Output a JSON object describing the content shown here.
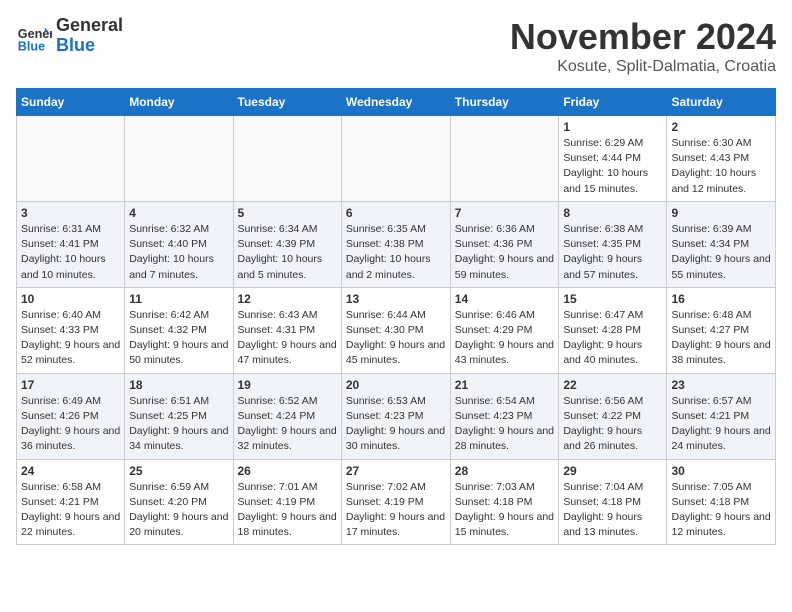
{
  "header": {
    "logo_general": "General",
    "logo_blue": "Blue",
    "month_title": "November 2024",
    "subtitle": "Kosute, Split-Dalmatia, Croatia"
  },
  "weekdays": [
    "Sunday",
    "Monday",
    "Tuesday",
    "Wednesday",
    "Thursday",
    "Friday",
    "Saturday"
  ],
  "weeks": [
    [
      {
        "day": "",
        "info": ""
      },
      {
        "day": "",
        "info": ""
      },
      {
        "day": "",
        "info": ""
      },
      {
        "day": "",
        "info": ""
      },
      {
        "day": "",
        "info": ""
      },
      {
        "day": "1",
        "info": "Sunrise: 6:29 AM\nSunset: 4:44 PM\nDaylight: 10 hours and 15 minutes."
      },
      {
        "day": "2",
        "info": "Sunrise: 6:30 AM\nSunset: 4:43 PM\nDaylight: 10 hours and 12 minutes."
      }
    ],
    [
      {
        "day": "3",
        "info": "Sunrise: 6:31 AM\nSunset: 4:41 PM\nDaylight: 10 hours and 10 minutes."
      },
      {
        "day": "4",
        "info": "Sunrise: 6:32 AM\nSunset: 4:40 PM\nDaylight: 10 hours and 7 minutes."
      },
      {
        "day": "5",
        "info": "Sunrise: 6:34 AM\nSunset: 4:39 PM\nDaylight: 10 hours and 5 minutes."
      },
      {
        "day": "6",
        "info": "Sunrise: 6:35 AM\nSunset: 4:38 PM\nDaylight: 10 hours and 2 minutes."
      },
      {
        "day": "7",
        "info": "Sunrise: 6:36 AM\nSunset: 4:36 PM\nDaylight: 9 hours and 59 minutes."
      },
      {
        "day": "8",
        "info": "Sunrise: 6:38 AM\nSunset: 4:35 PM\nDaylight: 9 hours and 57 minutes."
      },
      {
        "day": "9",
        "info": "Sunrise: 6:39 AM\nSunset: 4:34 PM\nDaylight: 9 hours and 55 minutes."
      }
    ],
    [
      {
        "day": "10",
        "info": "Sunrise: 6:40 AM\nSunset: 4:33 PM\nDaylight: 9 hours and 52 minutes."
      },
      {
        "day": "11",
        "info": "Sunrise: 6:42 AM\nSunset: 4:32 PM\nDaylight: 9 hours and 50 minutes."
      },
      {
        "day": "12",
        "info": "Sunrise: 6:43 AM\nSunset: 4:31 PM\nDaylight: 9 hours and 47 minutes."
      },
      {
        "day": "13",
        "info": "Sunrise: 6:44 AM\nSunset: 4:30 PM\nDaylight: 9 hours and 45 minutes."
      },
      {
        "day": "14",
        "info": "Sunrise: 6:46 AM\nSunset: 4:29 PM\nDaylight: 9 hours and 43 minutes."
      },
      {
        "day": "15",
        "info": "Sunrise: 6:47 AM\nSunset: 4:28 PM\nDaylight: 9 hours and 40 minutes."
      },
      {
        "day": "16",
        "info": "Sunrise: 6:48 AM\nSunset: 4:27 PM\nDaylight: 9 hours and 38 minutes."
      }
    ],
    [
      {
        "day": "17",
        "info": "Sunrise: 6:49 AM\nSunset: 4:26 PM\nDaylight: 9 hours and 36 minutes."
      },
      {
        "day": "18",
        "info": "Sunrise: 6:51 AM\nSunset: 4:25 PM\nDaylight: 9 hours and 34 minutes."
      },
      {
        "day": "19",
        "info": "Sunrise: 6:52 AM\nSunset: 4:24 PM\nDaylight: 9 hours and 32 minutes."
      },
      {
        "day": "20",
        "info": "Sunrise: 6:53 AM\nSunset: 4:23 PM\nDaylight: 9 hours and 30 minutes."
      },
      {
        "day": "21",
        "info": "Sunrise: 6:54 AM\nSunset: 4:23 PM\nDaylight: 9 hours and 28 minutes."
      },
      {
        "day": "22",
        "info": "Sunrise: 6:56 AM\nSunset: 4:22 PM\nDaylight: 9 hours and 26 minutes."
      },
      {
        "day": "23",
        "info": "Sunrise: 6:57 AM\nSunset: 4:21 PM\nDaylight: 9 hours and 24 minutes."
      }
    ],
    [
      {
        "day": "24",
        "info": "Sunrise: 6:58 AM\nSunset: 4:21 PM\nDaylight: 9 hours and 22 minutes."
      },
      {
        "day": "25",
        "info": "Sunrise: 6:59 AM\nSunset: 4:20 PM\nDaylight: 9 hours and 20 minutes."
      },
      {
        "day": "26",
        "info": "Sunrise: 7:01 AM\nSunset: 4:19 PM\nDaylight: 9 hours and 18 minutes."
      },
      {
        "day": "27",
        "info": "Sunrise: 7:02 AM\nSunset: 4:19 PM\nDaylight: 9 hours and 17 minutes."
      },
      {
        "day": "28",
        "info": "Sunrise: 7:03 AM\nSunset: 4:18 PM\nDaylight: 9 hours and 15 minutes."
      },
      {
        "day": "29",
        "info": "Sunrise: 7:04 AM\nSunset: 4:18 PM\nDaylight: 9 hours and 13 minutes."
      },
      {
        "day": "30",
        "info": "Sunrise: 7:05 AM\nSunset: 4:18 PM\nDaylight: 9 hours and 12 minutes."
      }
    ]
  ]
}
